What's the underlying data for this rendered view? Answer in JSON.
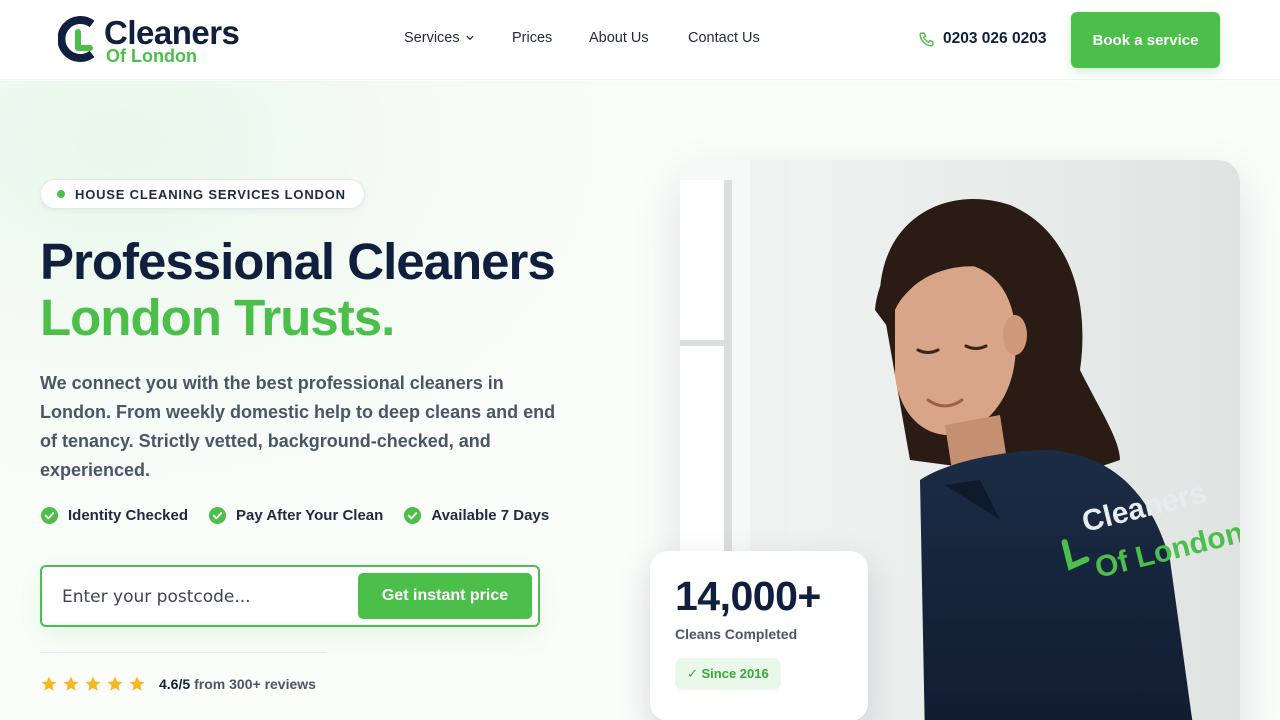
{
  "brand": {
    "name_line1": "Cleaners",
    "name_line2": "Of London",
    "accent_color": "#4cbf4a",
    "navy_color": "#0f1f3d"
  },
  "nav": {
    "items": [
      {
        "label": "Services",
        "has_dropdown": true
      },
      {
        "label": "Prices"
      },
      {
        "label": "About Us"
      },
      {
        "label": "Contact Us"
      }
    ]
  },
  "header": {
    "phone_icon": "phone-icon",
    "phone": "0203 026 0203",
    "cta_label": "Book a service"
  },
  "hero": {
    "badge": "HOUSE CLEANING SERVICES LONDON",
    "title_line1": "Professional Cleaners",
    "title_line2": "London Trusts.",
    "description": "We connect you with the best professional cleaners in London. From weekly domestic help to deep cleans and end of tenancy. Strictly vetted, background-checked, and experienced.",
    "checks": [
      "Identity Checked",
      "Pay After Your Clean",
      "Available 7 Days"
    ],
    "postcode_placeholder": "Enter your postcode...",
    "postcode_button": "Get instant price",
    "rating": {
      "stars": 5,
      "score": "4.6/5",
      "text": "from 300+ reviews"
    }
  },
  "stats": {
    "number": "14,000+",
    "label": "Cleans Completed",
    "pill": "✓ Since 2016"
  }
}
